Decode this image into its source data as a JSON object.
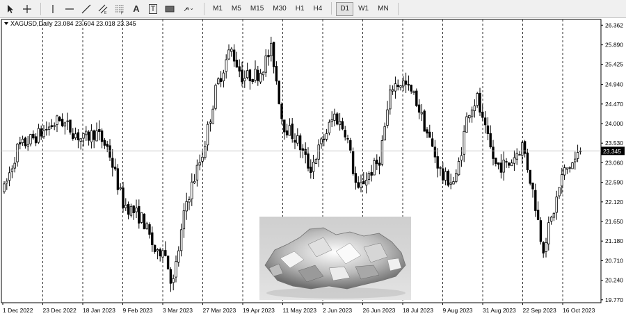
{
  "toolbar": {
    "tools": [
      {
        "name": "cursor-icon"
      },
      {
        "name": "crosshair-icon"
      },
      {
        "name": "vertical-line-icon"
      },
      {
        "name": "horizontal-line-icon"
      },
      {
        "name": "trendline-icon"
      },
      {
        "name": "equidistant-channel-icon"
      },
      {
        "name": "fibonacci-icon"
      },
      {
        "name": "text-icon",
        "glyph": "A"
      },
      {
        "name": "text-label-icon",
        "glyph": "T"
      },
      {
        "name": "shapes-icon"
      },
      {
        "name": "arrows-icon"
      }
    ],
    "timeframes": [
      "M1",
      "M5",
      "M15",
      "M30",
      "H1",
      "H4",
      "D1",
      "W1",
      "MN"
    ],
    "active_timeframe": "D1"
  },
  "chart": {
    "symbol_info": "XAGUSD,Daily  23.084 23.604 23.018 23.345",
    "current_price_label": "23.345",
    "colors": {
      "background": "#ffffff",
      "candles": "#000000",
      "grid": "#000000",
      "price_tag": "#000000"
    }
  },
  "chart_data": {
    "type": "candlestick",
    "symbol": "XAGUSD",
    "timeframe": "Daily",
    "last_bar": {
      "open": 23.084,
      "high": 23.604,
      "low": 23.018,
      "close": 23.345
    },
    "ylim": [
      19.7,
      26.5
    ],
    "y_ticks": [
      26.362,
      25.89,
      25.425,
      24.94,
      24.47,
      24.0,
      23.53,
      23.06,
      22.59,
      22.12,
      21.65,
      21.18,
      20.71,
      20.24,
      19.77
    ],
    "x_ticks": [
      "1 Dec 2022",
      "23 Dec 2022",
      "18 Jan 2023",
      "9 Feb 2023",
      "3 Mar 2023",
      "27 Mar 2023",
      "19 Apr 2023",
      "11 May 2023",
      "2 Jun 2023",
      "26 Jun 2023",
      "18 Jul 2023",
      "9 Aug 2023",
      "31 Aug 2023",
      "22 Sep 2023",
      "16 Oct 2023"
    ],
    "close_path": [
      {
        "date": "1 Dec 2022",
        "price": 22.3
      },
      {
        "date": "9 Dec 2022",
        "price": 23.4
      },
      {
        "date": "23 Dec 2022",
        "price": 23.8
      },
      {
        "date": "3 Jan 2023",
        "price": 24.1
      },
      {
        "date": "18 Jan 2023",
        "price": 23.6
      },
      {
        "date": "25 Jan 2023",
        "price": 23.8
      },
      {
        "date": "1 Feb 2023",
        "price": 23.4
      },
      {
        "date": "9 Feb 2023",
        "price": 22.1
      },
      {
        "date": "20 Feb 2023",
        "price": 21.7
      },
      {
        "date": "28 Feb 2023",
        "price": 20.8
      },
      {
        "date": "3 Mar 2023",
        "price": 21.1
      },
      {
        "date": "9 Mar 2023",
        "price": 20.1
      },
      {
        "date": "17 Mar 2023",
        "price": 22.1
      },
      {
        "date": "27 Mar 2023",
        "price": 23.3
      },
      {
        "date": "4 Apr 2023",
        "price": 24.9
      },
      {
        "date": "12 Apr 2023",
        "price": 25.8
      },
      {
        "date": "19 Apr 2023",
        "price": 25.1
      },
      {
        "date": "28 Apr 2023",
        "price": 25.2
      },
      {
        "date": "5 May 2023",
        "price": 25.8
      },
      {
        "date": "11 May 2023",
        "price": 24.0
      },
      {
        "date": "19 May 2023",
        "price": 23.6
      },
      {
        "date": "26 May 2023",
        "price": 22.9
      },
      {
        "date": "2 Jun 2023",
        "price": 23.6
      },
      {
        "date": "9 Jun 2023",
        "price": 24.2
      },
      {
        "date": "16 Jun 2023",
        "price": 23.8
      },
      {
        "date": "23 Jun 2023",
        "price": 22.3
      },
      {
        "date": "26 Jun 2023",
        "price": 22.6
      },
      {
        "date": "5 Jul 2023",
        "price": 23.1
      },
      {
        "date": "12 Jul 2023",
        "price": 24.9
      },
      {
        "date": "18 Jul 2023",
        "price": 25.0
      },
      {
        "date": "25 Jul 2023",
        "price": 24.6
      },
      {
        "date": "1 Aug 2023",
        "price": 23.7
      },
      {
        "date": "9 Aug 2023",
        "price": 22.7
      },
      {
        "date": "16 Aug 2023",
        "price": 22.6
      },
      {
        "date": "23 Aug 2023",
        "price": 24.3
      },
      {
        "date": "28 Aug 2023",
        "price": 24.6
      },
      {
        "date": "31 Aug 2023",
        "price": 24.0
      },
      {
        "date": "7 Sep 2023",
        "price": 23.0
      },
      {
        "date": "14 Sep 2023",
        "price": 23.0
      },
      {
        "date": "22 Sep 2023",
        "price": 23.5
      },
      {
        "date": "29 Sep 2023",
        "price": 22.2
      },
      {
        "date": "4 Oct 2023",
        "price": 21.0
      },
      {
        "date": "10 Oct 2023",
        "price": 21.8
      },
      {
        "date": "16 Oct 2023",
        "price": 22.8
      },
      {
        "date": "23 Oct 2023",
        "price": 23.1
      },
      {
        "date": "27 Oct 2023",
        "price": 23.345
      }
    ],
    "grid": "vertical dashed separators at x-ticks",
    "current_price_line": 23.345
  }
}
